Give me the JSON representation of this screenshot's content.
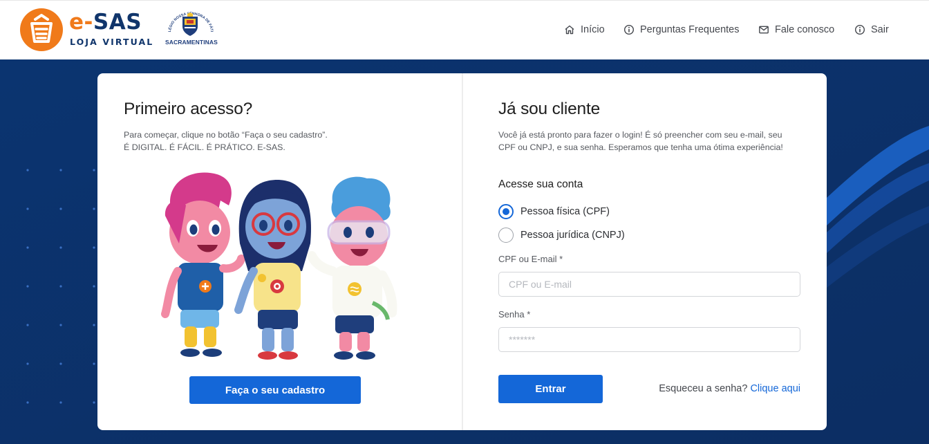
{
  "header": {
    "logo_e": "e-",
    "logo_sas": "SAS",
    "logo_sub": "LOJA VIRTUAL",
    "school_name": "SACRAMENTINAS",
    "school_arc_text": "COLÉGIO NOSSA SENHORA DE FÁTIMA",
    "nav": [
      {
        "label": "Início",
        "icon": "home-icon"
      },
      {
        "label": "Perguntas Frequentes",
        "icon": "info-icon"
      },
      {
        "label": "Fale conosco",
        "icon": "mail-icon"
      },
      {
        "label": "Sair",
        "icon": "info-icon"
      }
    ]
  },
  "left": {
    "title": "Primeiro acesso?",
    "desc_line1": "Para começar, clique no botão “Faça o seu cadastro”.",
    "desc_line2": "É DIGITAL. É FÁCIL. É PRÁTICO. E-SAS.",
    "signup_button": "Faça o seu cadastro"
  },
  "right": {
    "title": "Já sou cliente",
    "desc": "Você já está pronto para fazer o login! É só preencher com seu e-mail, seu CPF ou CNPJ, e sua senha. Esperamos que tenha uma ótima experiência!",
    "access_title": "Acesse sua conta",
    "radio_cpf": "Pessoa física (CPF)",
    "radio_cnpj": "Pessoa jurídica (CNPJ)",
    "login_label": "CPF ou E-mail",
    "login_placeholder": "CPF ou E-mail",
    "password_label": "Senha",
    "password_placeholder": "*******",
    "required_mark": "*",
    "submit_button": "Entrar",
    "forgot_text": "Esqueceu a senha?",
    "forgot_link": "Clique aqui"
  },
  "colors": {
    "brand_orange": "#f07a1a",
    "brand_navy": "#10356b",
    "primary_blue": "#1467d8",
    "background": "#0d3470"
  }
}
